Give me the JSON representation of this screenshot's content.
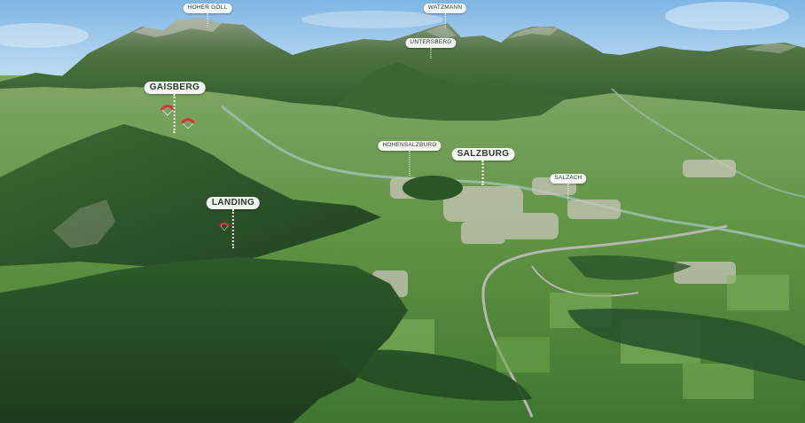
{
  "map": {
    "labels": {
      "hoher_goell": "HOHER GÖLL",
      "watzmann": "WATZMANN",
      "untersberg": "UNTERSBERG",
      "gaisberg": "GAISBERG",
      "hohensalzburg": "HOHENSALZBURG",
      "salzburg": "SALZBURG",
      "salzach": "SALZACH",
      "landing": "LANDING"
    },
    "icons": [
      "paraglider-icon",
      "paraglider-icon",
      "paraglider-icon"
    ],
    "colors": {
      "sky": "#a9d2ef",
      "mountain": "#3f6b37",
      "valley": "#5f8f45",
      "river": "#8fb3a8",
      "paraglider": "#d8333a"
    }
  }
}
